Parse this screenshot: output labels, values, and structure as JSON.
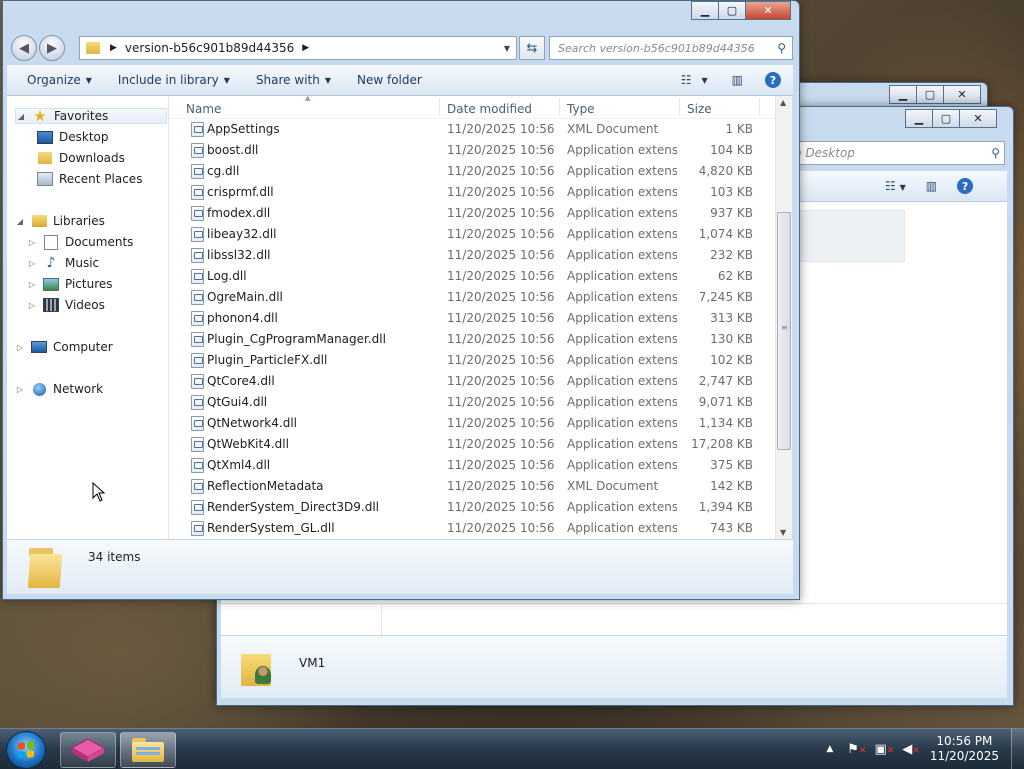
{
  "back_window_2": {
    "close_glyph": "✕"
  },
  "back_window": {
    "search_partial": "h Desktop",
    "details": {
      "name": "VM1"
    }
  },
  "explorer": {
    "address_path": "version-b56c901b89d44356",
    "search_placeholder": "Search version-b56c901b89d44356",
    "toolbar": {
      "organize": "Organize",
      "include_in_library": "Include in library",
      "share_with": "Share with",
      "new_folder": "New folder"
    },
    "nav": {
      "favorites": "Favorites",
      "desktop": "Desktop",
      "downloads": "Downloads",
      "recent_places": "Recent Places",
      "libraries": "Libraries",
      "documents": "Documents",
      "music": "Music",
      "pictures": "Pictures",
      "videos": "Videos",
      "computer": "Computer",
      "network": "Network"
    },
    "columns": {
      "name": "Name",
      "date": "Date modified",
      "type": "Type",
      "size": "Size"
    },
    "files": [
      {
        "name": "AppSettings",
        "date": "11/20/2025 10:56 ...",
        "type": "XML Document",
        "size": "1 KB"
      },
      {
        "name": "boost.dll",
        "date": "11/20/2025 10:56 ...",
        "type": "Application extens...",
        "size": "104 KB"
      },
      {
        "name": "cg.dll",
        "date": "11/20/2025 10:56 ...",
        "type": "Application extens...",
        "size": "4,820 KB"
      },
      {
        "name": "crisprmf.dll",
        "date": "11/20/2025 10:56 ...",
        "type": "Application extens...",
        "size": "103 KB"
      },
      {
        "name": "fmodex.dll",
        "date": "11/20/2025 10:56 ...",
        "type": "Application extens...",
        "size": "937 KB"
      },
      {
        "name": "libeay32.dll",
        "date": "11/20/2025 10:56 ...",
        "type": "Application extens...",
        "size": "1,074 KB"
      },
      {
        "name": "libssl32.dll",
        "date": "11/20/2025 10:56 ...",
        "type": "Application extens...",
        "size": "232 KB"
      },
      {
        "name": "Log.dll",
        "date": "11/20/2025 10:56 ...",
        "type": "Application extens...",
        "size": "62 KB"
      },
      {
        "name": "OgreMain.dll",
        "date": "11/20/2025 10:56 ...",
        "type": "Application extens...",
        "size": "7,245 KB"
      },
      {
        "name": "phonon4.dll",
        "date": "11/20/2025 10:56 ...",
        "type": "Application extens...",
        "size": "313 KB"
      },
      {
        "name": "Plugin_CgProgramManager.dll",
        "date": "11/20/2025 10:56 ...",
        "type": "Application extens...",
        "size": "130 KB"
      },
      {
        "name": "Plugin_ParticleFX.dll",
        "date": "11/20/2025 10:56 ...",
        "type": "Application extens...",
        "size": "102 KB"
      },
      {
        "name": "QtCore4.dll",
        "date": "11/20/2025 10:56 ...",
        "type": "Application extens...",
        "size": "2,747 KB"
      },
      {
        "name": "QtGui4.dll",
        "date": "11/20/2025 10:56 ...",
        "type": "Application extens...",
        "size": "9,071 KB"
      },
      {
        "name": "QtNetwork4.dll",
        "date": "11/20/2025 10:56 ...",
        "type": "Application extens...",
        "size": "1,134 KB"
      },
      {
        "name": "QtWebKit4.dll",
        "date": "11/20/2025 10:56 ...",
        "type": "Application extens...",
        "size": "17,208 KB"
      },
      {
        "name": "QtXml4.dll",
        "date": "11/20/2025 10:56 ...",
        "type": "Application extens...",
        "size": "375 KB"
      },
      {
        "name": "ReflectionMetadata",
        "date": "11/20/2025 10:56 ...",
        "type": "XML Document",
        "size": "142 KB"
      },
      {
        "name": "RenderSystem_Direct3D9.dll",
        "date": "11/20/2025 10:56 ...",
        "type": "Application extens...",
        "size": "1,394 KB"
      },
      {
        "name": "RenderSystem_GL.dll",
        "date": "11/20/2025 10:56 ...",
        "type": "Application extens...",
        "size": "743 KB"
      }
    ],
    "status": {
      "count": "34 items"
    }
  },
  "taskbar": {
    "clock_time": "10:56 PM",
    "clock_date": "11/20/2025"
  }
}
